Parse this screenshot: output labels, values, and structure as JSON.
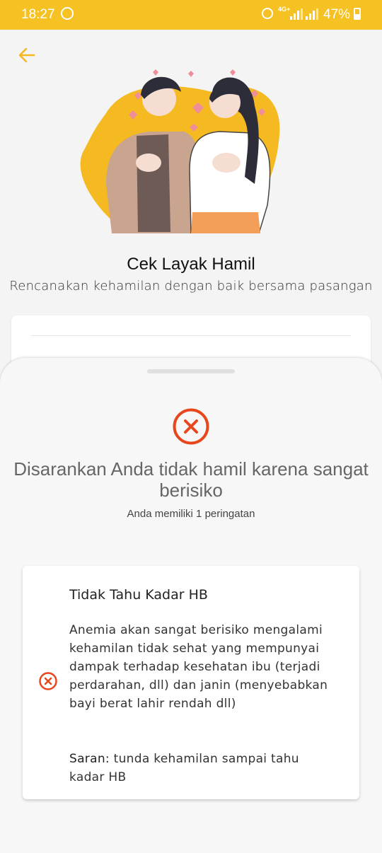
{
  "status_bar": {
    "time": "18:27",
    "network": "4G+",
    "battery": "47%",
    "icons": [
      "whatsapp-icon",
      "alarm-icon",
      "signal-icon",
      "signal-icon",
      "battery-icon"
    ]
  },
  "header": {
    "back_icon": "arrow-left-icon",
    "title": "Cek Layak Hamil",
    "subtitle": "Rencanakan kehamilan dengan baik bersama pasangan"
  },
  "sheet": {
    "title": "Disarankan Anda tidak hamil karena sangat berisiko",
    "warning_count": "Anda memiliki 1 peringatan",
    "items": [
      {
        "title": "Tidak Tahu Kadar HB",
        "description": "Anemia akan sangat berisiko mengalami kehamilan tidak sehat yang mempunyai dampak terhadap kesehatan ibu (terjadi perdarahan, dll) dan janin (menyebabkan bayi berat lahir rendah dll)",
        "advice_label": "Saran:",
        "advice": " tunda kehamilan sampai tahu kadar HB"
      }
    ]
  },
  "colors": {
    "status_bar": "#f5c123",
    "accent": "#f5b921",
    "danger": "#e8471e"
  }
}
